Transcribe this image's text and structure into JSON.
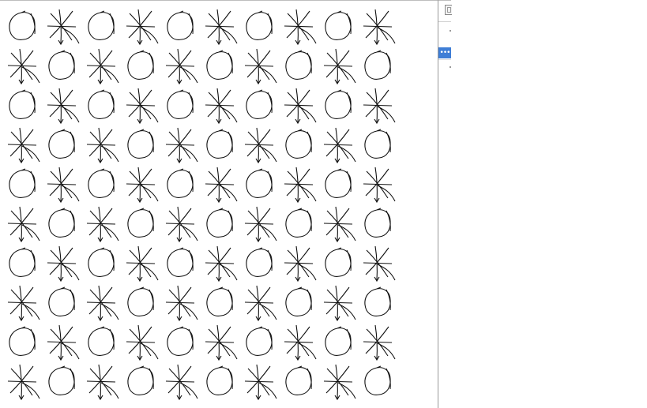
{
  "canvas": {
    "pattern_rows": [
      [
        "circle",
        "star",
        "circle",
        "star",
        "circle",
        "star",
        "circle",
        "star",
        "circle",
        "star"
      ],
      [
        "star",
        "circle",
        "star",
        "circle",
        "star",
        "circle",
        "star",
        "circle",
        "star",
        "circle"
      ],
      [
        "circle",
        "star",
        "circle",
        "star",
        "circle",
        "star",
        "circle",
        "star",
        "circle",
        "star"
      ],
      [
        "star",
        "circle",
        "star",
        "circle",
        "star",
        "circle",
        "star",
        "circle",
        "star",
        "circle"
      ],
      [
        "circle",
        "star",
        "circle",
        "star",
        "circle",
        "star",
        "circle",
        "star",
        "circle",
        "star"
      ],
      [
        "star",
        "circle",
        "star",
        "circle",
        "star",
        "circle",
        "star",
        "circle",
        "star",
        "circle"
      ],
      [
        "circle",
        "star",
        "circle",
        "star",
        "circle",
        "star",
        "circle",
        "star",
        "circle",
        "star"
      ],
      [
        "star",
        "circle",
        "star",
        "circle",
        "star",
        "circle",
        "star",
        "circle",
        "star",
        "circle"
      ],
      [
        "circle",
        "star",
        "circle",
        "star",
        "circle",
        "star",
        "circle",
        "star",
        "circle",
        "star"
      ],
      [
        "star",
        "circle",
        "star",
        "circle",
        "star",
        "circle",
        "star",
        "circle",
        "star",
        "circle"
      ]
    ],
    "stroke_color": "#111111"
  },
  "side_panel": {
    "toggle_icon": "panel-toggle-icon",
    "more_button_label": "•••",
    "more_button_color": "#3f7ed6"
  }
}
